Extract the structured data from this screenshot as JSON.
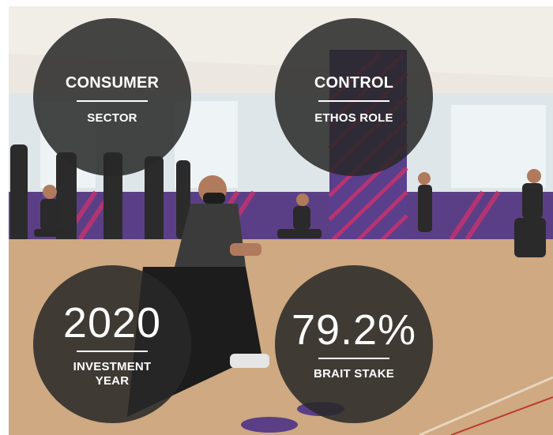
{
  "stats": [
    {
      "value": "CONSUMER",
      "label": "SECTOR"
    },
    {
      "value": "CONTROL",
      "label": "ETHOS ROLE"
    },
    {
      "value": "2020",
      "label": "INVESTMENT YEAR"
    },
    {
      "value": "79.2%",
      "label": "BRAIT STAKE"
    }
  ],
  "colors": {
    "circle_fill": "#282828",
    "text": "#ffffff",
    "pillar_purple": "#5a3f8c",
    "pillar_pink": "#c8326e",
    "floor": "#c9a27a"
  },
  "image": {
    "subject": "gym-fitness-class-photo"
  }
}
